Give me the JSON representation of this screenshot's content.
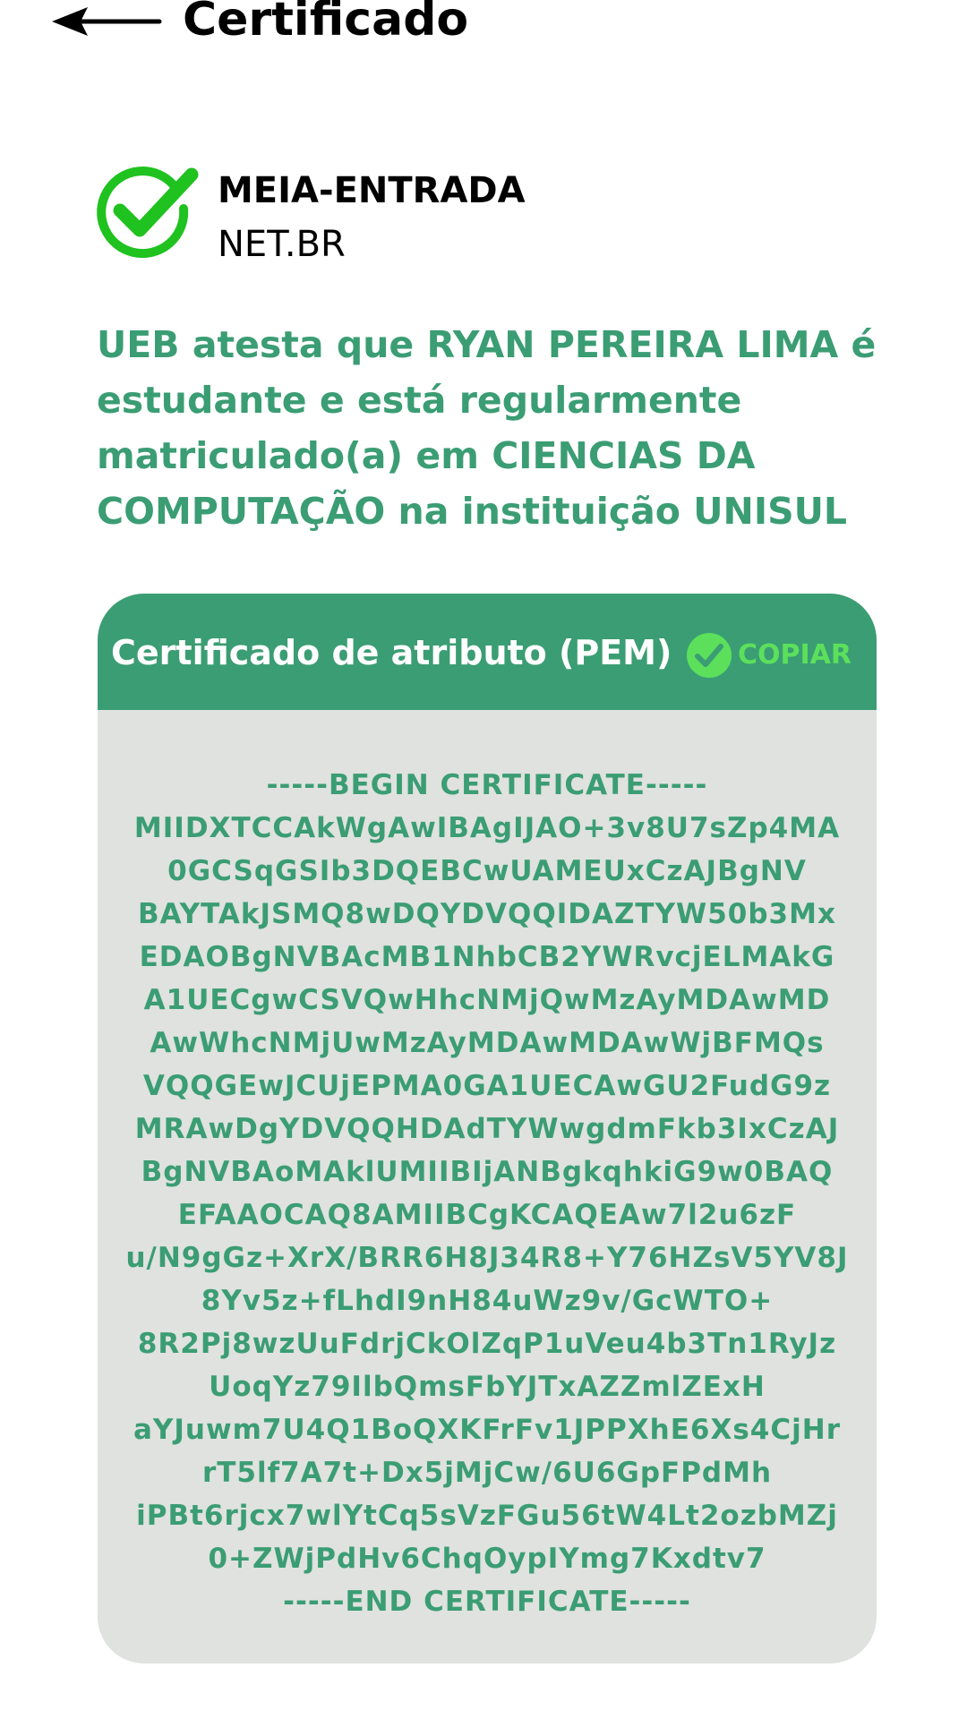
{
  "header": {
    "back_icon": "arrow-left-icon",
    "title": "Certificado"
  },
  "brand": {
    "icon": "check-circle-icon",
    "name": "MEIA-ENTRADA",
    "domain": "NET.BR"
  },
  "attestation": {
    "text": "UEB atesta que RYAN PEREIRA LIMA é estudante e está regularmente matriculado(a) em CIENCIAS DA COMPUTAÇÃO na instituição UNISUL"
  },
  "certificate": {
    "title": "Certificado de atributo (PEM)",
    "copy_icon": "check-circle-icon",
    "copy_label": "COPIAR",
    "lines": [
      "-----BEGIN CERTIFICATE-----",
      "MIIDXTCCAkWgAwIBAgIJAO+3v8U7sZp4MA",
      "0GCSqGSIb3DQEBCwUAMEUxCzAJBgNV",
      "BAYTAkJSMQ8wDQYDVQQIDAZTYW50b3Mx",
      "EDAOBgNVBAcMB1NhbCB2YWRvcjELMAkG",
      "A1UECgwCSVQwHhcNMjQwMzAyMDAwMD",
      "AwWhcNMjUwMzAyMDAwMDAwWjBFMQs",
      "VQQGEwJCUjEPMA0GA1UECAwGU2FudG9z",
      "MRAwDgYDVQQHDAdTYWwgdmFkb3IxCzAJ",
      "BgNVBAoMAklUMIIBIjANBgkqhkiG9w0BAQ",
      "EFAAOCAQ8AMIIBCgKCAQEAw7l2u6zF",
      "u/N9gGz+XrX/BRR6H8J34R8+Y76HZsV5YV8J",
      "8Yv5z+fLhdI9nH84uWz9v/GcWTO+",
      "8R2Pj8wzUuFdrjCkOlZqP1uVeu4b3Tn1RyJz",
      "UoqYz79IlbQmsFbYJTxAZZmlZExH",
      "aYJuwm7U4Q1BoQXKFrFv1JPPXhE6Xs4CjHr",
      "rT5lf7A7t+Dx5jMjCw/6U6GpFPdMh",
      "iPBt6rjcx7wlYtCq5sVzFGu56tW4Lt2ozbMZj",
      "0+ZWjPdHv6ChqOypIYmg7Kxdtv7",
      "-----END CERTIFICATE-----"
    ]
  },
  "colors": {
    "accent": "#3b9d73",
    "copy_green": "#5ce05c",
    "brand_check": "#1fc21f",
    "card_bg": "#dfe2df"
  }
}
